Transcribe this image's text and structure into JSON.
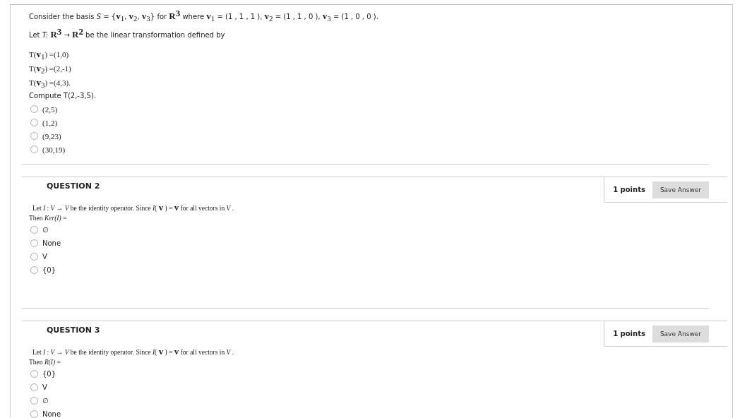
{
  "first_question": {
    "prompt_lines": [
      "Consider the basis *S* = {**v**$_{1}$, **v**$_{2}$, **v**$_{3}$} for **R**$^{3}$ where **v**$_{1}$ = (1 , 1 , 1 ), **v**$_{2}$ = (1 , 1 , 0 ), **v**$_{3}$ = (1 , 0 , 0 ).",
      "Let *T:* **R**$^{3}$ → **R**$^{2}$ be the linear transformation defined by"
    ],
    "definitions": [
      "T(**v**$_{1}$) =(1,0)",
      "T(**v**$_{2}$) =(2,-1)",
      "T(**v**$_{3}$) =(4,3)."
    ],
    "question": "Compute T(2,-3,5).",
    "options": [
      {
        "label": "(2,5)",
        "selected": false
      },
      {
        "label": "(1,2)",
        "selected": false
      },
      {
        "label": "(9,23)",
        "selected": false
      },
      {
        "label": "(30,19)",
        "selected": false
      }
    ]
  },
  "questions": [
    {
      "title": "QUESTION 2",
      "points": "1 points",
      "save_button": "Save Answer",
      "prompt_lines": [
        "Let *I* : *V* → *V* be the identity operator. Since *I*( **v** ) = **v** for all vectors in *V* .",
        "Then *Ker(I)* ="
      ],
      "options": [
        {
          "label": "∅",
          "selected": false
        },
        {
          "label": "None",
          "selected": false
        },
        {
          "label": "V",
          "selected": false
        },
        {
          "label": "{0}",
          "selected": false
        }
      ]
    },
    {
      "title": "QUESTION 3",
      "points": "1 points",
      "save_button": "Save Answer",
      "prompt_lines": [
        "Let *I* : *V* → *V* be the identity operator. Since *I*( **v** ) = **v** for all vectors in *V* .",
        "Then *R(I)* ="
      ],
      "options": [
        {
          "label": "{0}",
          "selected": false
        },
        {
          "label": "V",
          "selected": false
        },
        {
          "label": "∅",
          "selected": false
        },
        {
          "label": "None",
          "selected": false
        }
      ]
    }
  ]
}
